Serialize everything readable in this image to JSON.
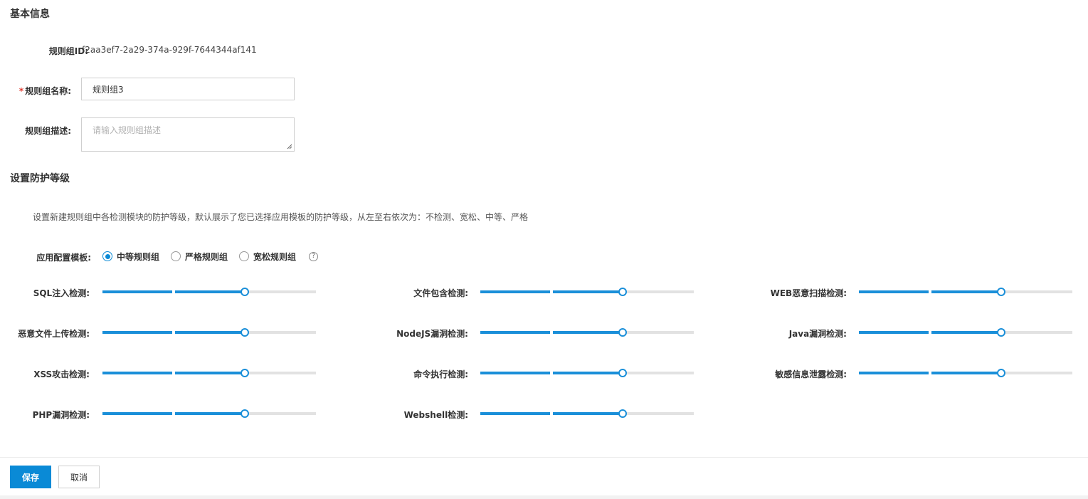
{
  "basic": {
    "title": "基本信息",
    "id_label": "规则组ID:",
    "id_value": "f2aa3ef7-2a29-374a-929f-7644344af141",
    "name_required_mark": "*",
    "name_label": "规则组名称:",
    "name_value": "规则组3",
    "desc_label": "规则组描述:",
    "desc_placeholder": "请输入规则组描述"
  },
  "protection": {
    "title": "设置防护等级",
    "description": "设置新建规则组中各检测模块的防护等级，默认展示了您已选择应用模板的防护等级，从左至右依次为：不检测、宽松、中等、严格",
    "template_label": "应用配置模板:",
    "templates": [
      {
        "label": "中等规则组",
        "checked": true
      },
      {
        "label": "严格规则组",
        "checked": false
      },
      {
        "label": "宽松规则组",
        "checked": false
      }
    ],
    "help_icon": "question-circle-icon",
    "levels": [
      "不检测",
      "宽松",
      "中等",
      "严格"
    ],
    "sliders": [
      {
        "label": "SQL注入检测:",
        "level": 2
      },
      {
        "label": "文件包含检测:",
        "level": 2
      },
      {
        "label": "WEB恶意扫描检测:",
        "level": 2
      },
      {
        "label": "恶意文件上传检测:",
        "level": 2
      },
      {
        "label": "NodeJS漏洞检测:",
        "level": 2
      },
      {
        "label": "Java漏洞检测:",
        "level": 2
      },
      {
        "label": "XSS攻击检测:",
        "level": 2
      },
      {
        "label": "命令执行检测:",
        "level": 2
      },
      {
        "label": "敏感信息泄露检测:",
        "level": 2
      },
      {
        "label": "PHP漏洞检测:",
        "level": 2
      },
      {
        "label": "Webshell检测:",
        "level": 2
      }
    ]
  },
  "footer": {
    "save_label": "保存",
    "cancel_label": "取消"
  },
  "colors": {
    "primary": "#0a8ad6",
    "slider_fill": "#1a8fd9",
    "required": "#e0362b"
  }
}
